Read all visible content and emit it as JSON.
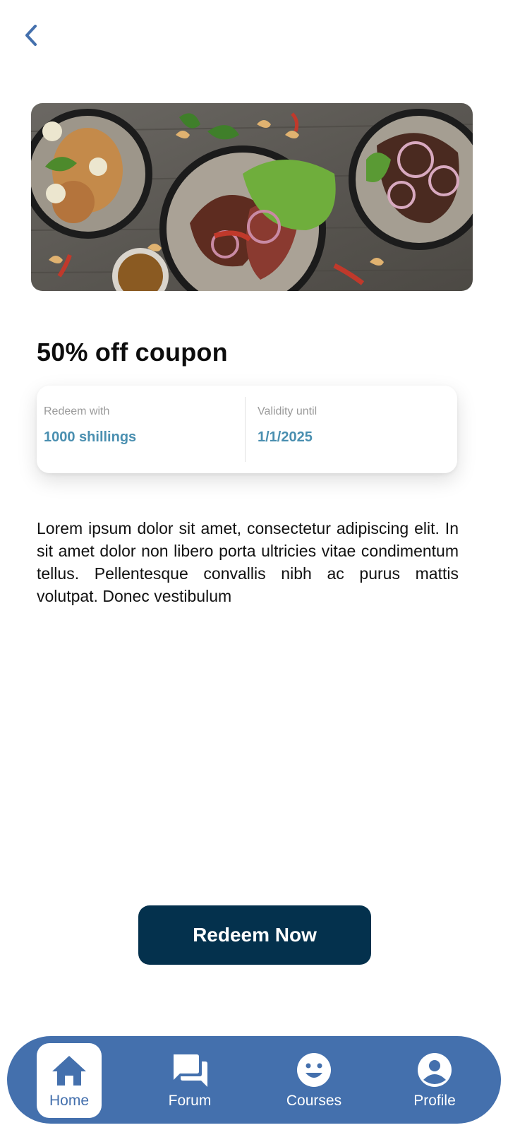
{
  "header": {
    "back_icon": "chevron-left-icon",
    "accent_color": "#4470ad"
  },
  "hero": {
    "image_description_icon": "food-platter-image"
  },
  "offer": {
    "title": "50% off coupon",
    "redeem_label": "Redeem with",
    "redeem_value": "1000 shillings",
    "validity_label": "Validity until",
    "validity_value": "1/1/2025",
    "value_color": "#4a8fb0"
  },
  "description": "Lorem ipsum dolor sit amet, consectetur adipiscing elit. In sit amet dolor non libero porta ultricies vitae condimentum tellus. Pellentesque convallis nibh ac purus mattis volutpat. Donec vestibulum",
  "actions": {
    "redeem_label": "Redeem Now",
    "button_color": "#04314d"
  },
  "nav": {
    "items": [
      {
        "label": "Home",
        "icon": "home-icon",
        "active": true
      },
      {
        "label": "Forum",
        "icon": "forum-icon",
        "active": false
      },
      {
        "label": "Courses",
        "icon": "smiley-icon",
        "active": false
      },
      {
        "label": "Profile",
        "icon": "profile-icon",
        "active": false
      }
    ]
  }
}
